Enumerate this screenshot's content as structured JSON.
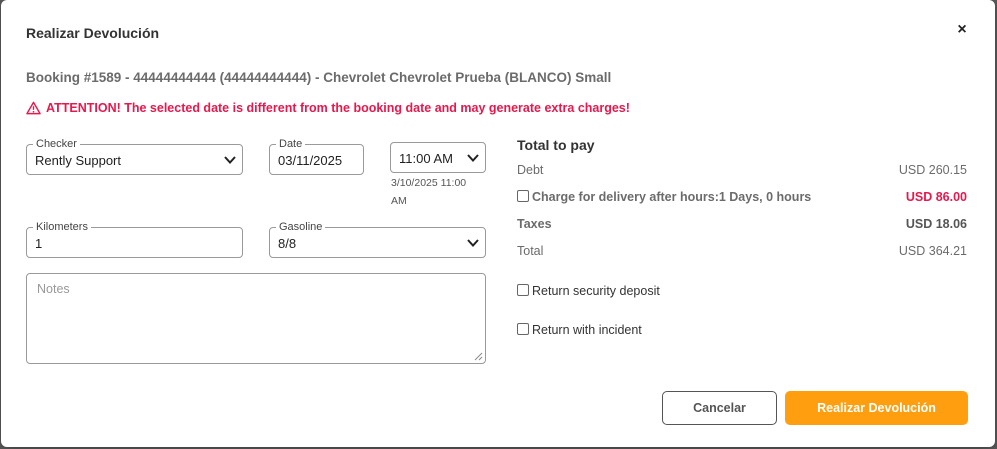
{
  "modal": {
    "title": "Realizar Devolución",
    "close": "×",
    "booking": "Booking #1589 - 44444444444 (44444444444) - Chevrolet Chevrolet Prueba (BLANCO) Small",
    "warning": "ATTENTION! The selected date is different from the booking date and may generate extra charges!"
  },
  "form": {
    "checker": {
      "label": "Checker",
      "value": "Rently Support"
    },
    "date": {
      "label": "Date",
      "value": "03/11/2025"
    },
    "time": {
      "value": "11:00 AM"
    },
    "date_hint": "3/10/2025 11:00 AM",
    "kilometers": {
      "label": "Kilometers",
      "value": "1"
    },
    "gasoline": {
      "label": "Gasoline",
      "value": "8/8"
    },
    "notes": {
      "placeholder": "Notes"
    }
  },
  "totals": {
    "title": "Total to pay",
    "debt": {
      "label": "Debt",
      "value": "USD 260.15"
    },
    "delivery": {
      "label": "Charge for delivery after hours:1 Days, 0 hours",
      "value": "USD 86.00"
    },
    "taxes": {
      "label": "Taxes",
      "value": "USD 18.06"
    },
    "total": {
      "label": "Total",
      "value": "USD 364.21"
    }
  },
  "options": {
    "security_deposit": "Return security deposit",
    "incident": "Return with incident"
  },
  "buttons": {
    "cancel": "Cancelar",
    "submit": "Realizar Devolución"
  },
  "colors": {
    "accent": "#ff9f10",
    "warning": "#e8174c"
  },
  "icons": {
    "warning": "warning-triangle-icon",
    "close": "close-icon",
    "dropdown": "chevron-down-icon"
  }
}
